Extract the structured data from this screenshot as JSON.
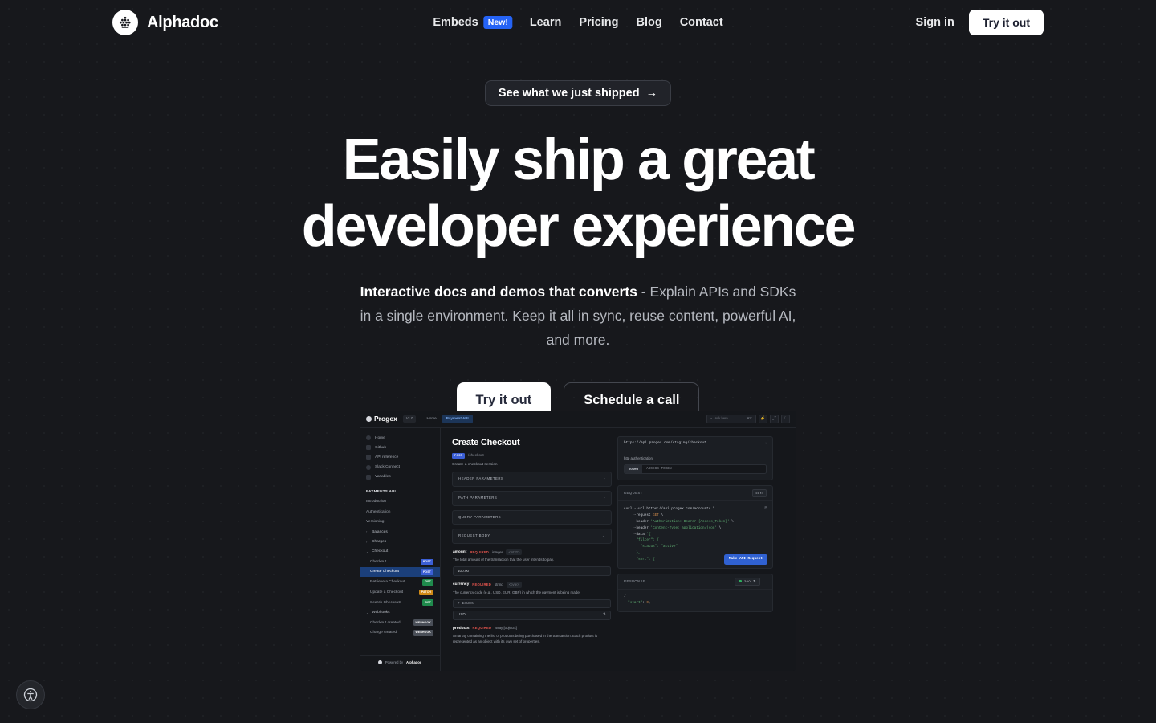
{
  "brand": {
    "name": "Alphadoc",
    "logo_icon": "alphadoc-dots-logo"
  },
  "nav": {
    "links": [
      {
        "label": "Embeds",
        "badge": "New!"
      },
      {
        "label": "Learn"
      },
      {
        "label": "Pricing"
      },
      {
        "label": "Blog"
      },
      {
        "label": "Contact"
      }
    ],
    "sign_in": "Sign in",
    "try_it_out": "Try it out",
    "badge_color": "#2563f5"
  },
  "hero": {
    "announcement": "See what we just shipped",
    "announcement_arrow": "→",
    "headline_line1": "Easily ship a great",
    "headline_line2": "developer experience",
    "sub_strong": "Interactive docs and demos that converts",
    "sub_rest": " - Explain APIs and SDKs in a single environment. Keep it all in sync, reuse content, powerful AI, and more.",
    "cta_primary": "Try it out",
    "cta_secondary": "Schedule a call"
  },
  "preview": {
    "topbar": {
      "brand": "Progex",
      "version_chip": "V1.0",
      "home": "Home",
      "active_tab": "Payment API",
      "search_placeholder": "Ask here",
      "search_shortcut": "⌘K",
      "icons": [
        "bolt-icon",
        "share-icon",
        "moon-icon"
      ]
    },
    "sidebar": {
      "nav": [
        {
          "label": "Home",
          "icon": "home-icon"
        },
        {
          "label": "Github",
          "icon": "github-icon"
        },
        {
          "label": "API reference",
          "icon": "api-icon"
        },
        {
          "label": "Slack Connect",
          "icon": "slack-icon"
        },
        {
          "label": "Variables",
          "icon": "variables-icon"
        }
      ],
      "section_title": "PAYMENTS API",
      "leaves": [
        "Introduction",
        "Authentication",
        "Versioning"
      ],
      "groups": [
        {
          "label": "Balances",
          "expanded": false
        },
        {
          "label": "Charges",
          "expanded": false
        },
        {
          "label": "Checkout",
          "expanded": true,
          "items": [
            {
              "label": "Checkout",
              "method": "POST",
              "active": false
            },
            {
              "label": "Create Checkout",
              "method": "POST",
              "active": true
            },
            {
              "label": "Retrieve a Checkout",
              "method": "GET",
              "active": false
            },
            {
              "label": "Update a Checkout",
              "method": "PATCH",
              "active": false
            },
            {
              "label": "Search Checkouts",
              "method": "GET",
              "active": false
            }
          ]
        },
        {
          "label": "Webhooks",
          "expanded": true,
          "items": [
            {
              "label": "Checkout created",
              "method": "WEBHOOK",
              "active": false
            },
            {
              "label": "Charge created",
              "method": "WEBHOOK",
              "active": false
            }
          ]
        }
      ],
      "powered_prefix": "Powered by",
      "powered_brand": "Alphadoc"
    },
    "doc": {
      "title": "Create Checkout",
      "method": "POST",
      "path": "/checkout",
      "description": "Create a checkout session",
      "accordions": [
        {
          "label": "HEADER PARAMETERS",
          "expanded": false
        },
        {
          "label": "PATH PARAMETERS",
          "expanded": false
        },
        {
          "label": "QUERY PARAMETERS",
          "expanded": false
        },
        {
          "label": "REQUEST BODY",
          "expanded": true
        }
      ],
      "fields": [
        {
          "name": "amount",
          "required": "REQUIRED",
          "type": "integer",
          "format": "<int32>",
          "description": "The total amount of the transaction that the user intends to pay.",
          "value": "100.00"
        },
        {
          "name": "currency",
          "required": "REQUIRED",
          "type": "string",
          "format": "<byte>",
          "description": "The currency code (e.g., USD, EUR, GBP) in which the payment is being made.",
          "enums_label": "Enums",
          "value": "USD"
        },
        {
          "name": "products",
          "required": "REQUIRED",
          "type": "array [objects]",
          "format": "",
          "description": "An array containing the list of products being purchased in the transaction. Each product is represented as an object with its own set of properties.",
          "value": ""
        }
      ]
    },
    "right": {
      "url": "https://api.progex.com/staging/checkout",
      "auth_label": "http authentication",
      "auth_key": "Token",
      "auth_value": "ACCESS-TOKEN",
      "request_label": "REQUEST",
      "request_lang": "curl",
      "code_lines": [
        "curl --url https://api.progex.com/accounts \\",
        "     --request GET \\",
        "     --header 'Authorization: Bearer {Access_Token}' \\",
        "     --header 'Content-Type: application/json' \\",
        "     --data '{",
        "       \"filter\": {",
        "         \"status\": \"active\"",
        "       },",
        "       \"sort\": {"
      ],
      "make_request": "Make API Request",
      "response_label": "RESPONSE",
      "status_code": "200",
      "response_lines": [
        "{",
        "  \"start\": 0,"
      ]
    }
  },
  "fab": {
    "icon": "accessibility-icon"
  }
}
